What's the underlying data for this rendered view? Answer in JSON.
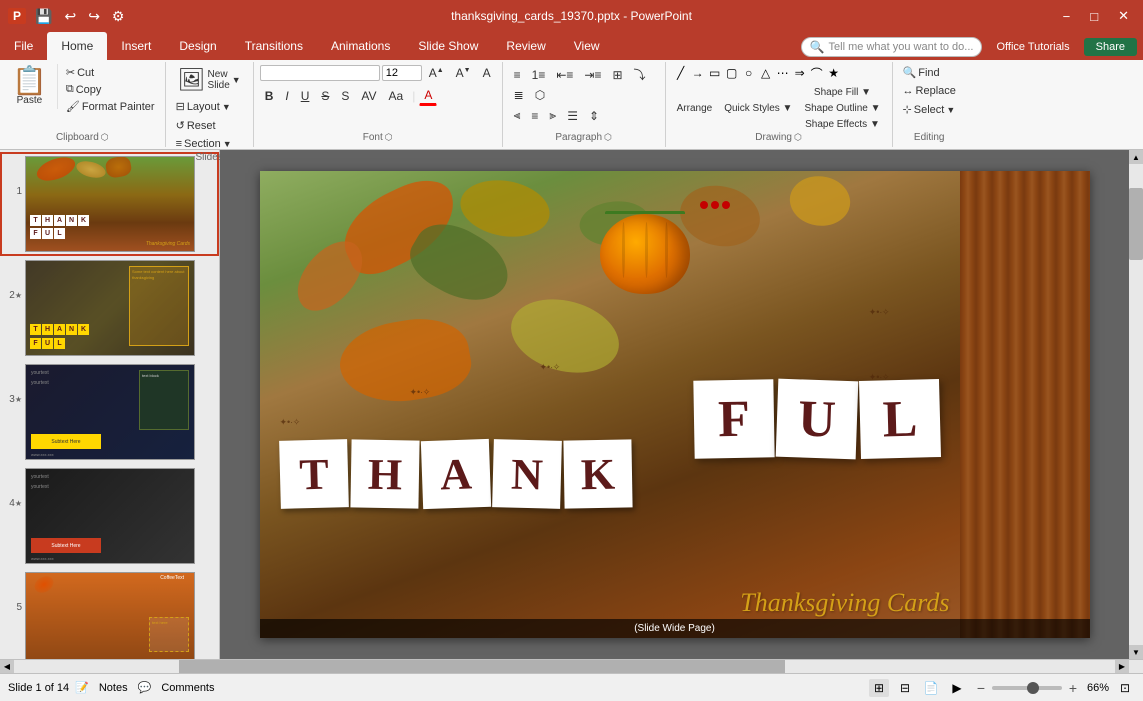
{
  "window": {
    "title": "thanksgiving_cards_19370.pptx - PowerPoint"
  },
  "titleBar": {
    "save_icon": "💾",
    "undo_icon": "↩",
    "redo_icon": "↪",
    "customize_icon": "⚙",
    "close_label": "✕",
    "minimize_label": "−",
    "maximize_label": "□"
  },
  "ribbon": {
    "tabs": [
      "File",
      "Home",
      "Insert",
      "Design",
      "Transitions",
      "Animations",
      "Slide Show",
      "Review",
      "View"
    ],
    "active_tab": "Home",
    "groups": {
      "clipboard": {
        "label": "Clipboard",
        "paste": "Paste",
        "cut": "✂",
        "copy": "⧉",
        "format_painter": "🖌"
      },
      "slides": {
        "label": "Slides",
        "new_slide": "New\nSlide",
        "layout": "Layout",
        "reset": "Reset",
        "section": "Section"
      },
      "font": {
        "label": "Font",
        "font_name": "",
        "font_size": "12",
        "bold": "B",
        "italic": "I",
        "underline": "U",
        "strikethrough": "S",
        "shadow": "S",
        "increase_size": "A↑",
        "decrease_size": "A↓",
        "clear_format": "A"
      },
      "paragraph": {
        "label": "Paragraph"
      },
      "drawing": {
        "label": "Drawing"
      },
      "editing": {
        "label": "Editing",
        "find": "Find",
        "replace": "Replace",
        "select": "Select"
      }
    }
  },
  "helpBar": {
    "search_placeholder": "Tell me what you want to do...",
    "office_tutorials": "Office Tutorials",
    "share": "Share"
  },
  "slides": {
    "slide1": {
      "num": "1",
      "is_active": true
    },
    "slide2": {
      "num": "2",
      "has_star": true
    },
    "slide3": {
      "num": "3",
      "has_star": true
    },
    "slide4": {
      "num": "4",
      "has_star": true
    },
    "slide5": {
      "num": "5"
    }
  },
  "mainSlide": {
    "letters_row1": [
      "T",
      "H",
      "A",
      "N",
      "K"
    ],
    "letters_row2": [
      "F",
      "U",
      "L"
    ],
    "thanksgiving_text": "Thanksgiving Cards",
    "guide_text": "(Slide Wide Page)"
  },
  "statusBar": {
    "slide_info": "Slide 1 of 14",
    "notes": "Notes",
    "comments": "Comments",
    "zoom": "66%"
  },
  "shapeTools": {
    "shape_fill": "Shape Fill ~",
    "shape_outline": "Shape Outline ~",
    "shape_effects": "Shape Effects ~",
    "quick_styles": "Quick Styles ~",
    "arrange": "Arrange",
    "select": "Select ~"
  }
}
